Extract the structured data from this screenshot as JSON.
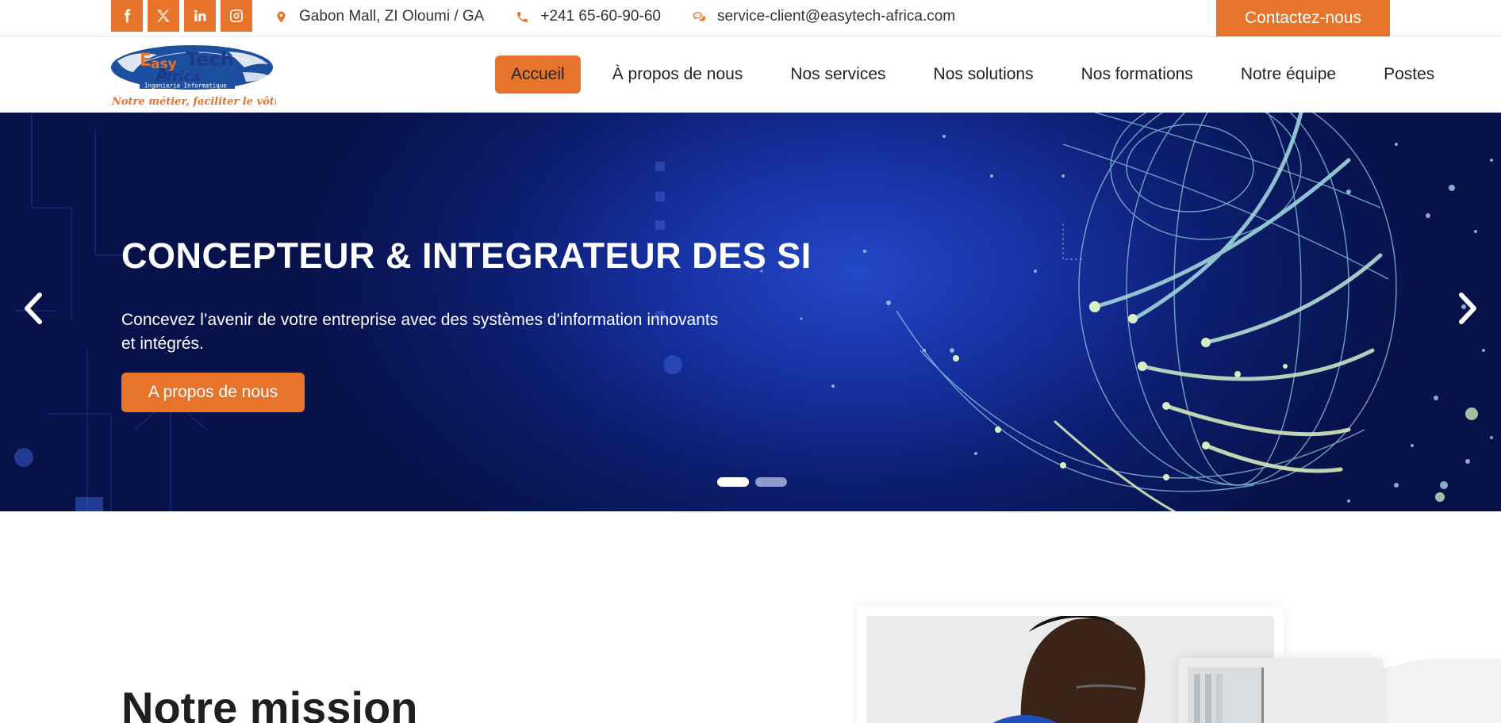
{
  "topbar": {
    "social": [
      {
        "name": "facebook-icon"
      },
      {
        "name": "x-twitter-icon"
      },
      {
        "name": "linkedin-icon"
      },
      {
        "name": "instagram-icon"
      }
    ],
    "address": "Gabon Mall, ZI Oloumi / GA",
    "phone": "+241 65-60-90-60",
    "email": "service-client@easytech-africa.com",
    "contact_button": "Contactez-nous"
  },
  "logo": {
    "brand_easy": "EasyTech",
    "brand_africa": "Africa",
    "subtitle": "Ingenierie Informatique",
    "tagline": "Notre métier, faciliter le vôtre"
  },
  "nav": {
    "items": [
      {
        "label": "Accueil",
        "active": true
      },
      {
        "label": "À propos de nous",
        "active": false
      },
      {
        "label": "Nos services",
        "active": false
      },
      {
        "label": "Nos solutions",
        "active": false
      },
      {
        "label": "Nos formations",
        "active": false
      },
      {
        "label": "Notre équipe",
        "active": false
      },
      {
        "label": "Postes",
        "active": false
      }
    ]
  },
  "hero": {
    "title": "CONCEPTEUR & INTEGRATEUR DES SI",
    "text": "Concevez l’avenir de votre entreprise avec des systèmes d'information innovants et intégrés.",
    "button": "A propos de nous",
    "slide_count": 2,
    "active_slide": 1
  },
  "mission": {
    "title": "Notre mission"
  },
  "colors": {
    "accent": "#e8742c",
    "hero_dark": "#07124a",
    "hero_mid": "#1630a0"
  }
}
